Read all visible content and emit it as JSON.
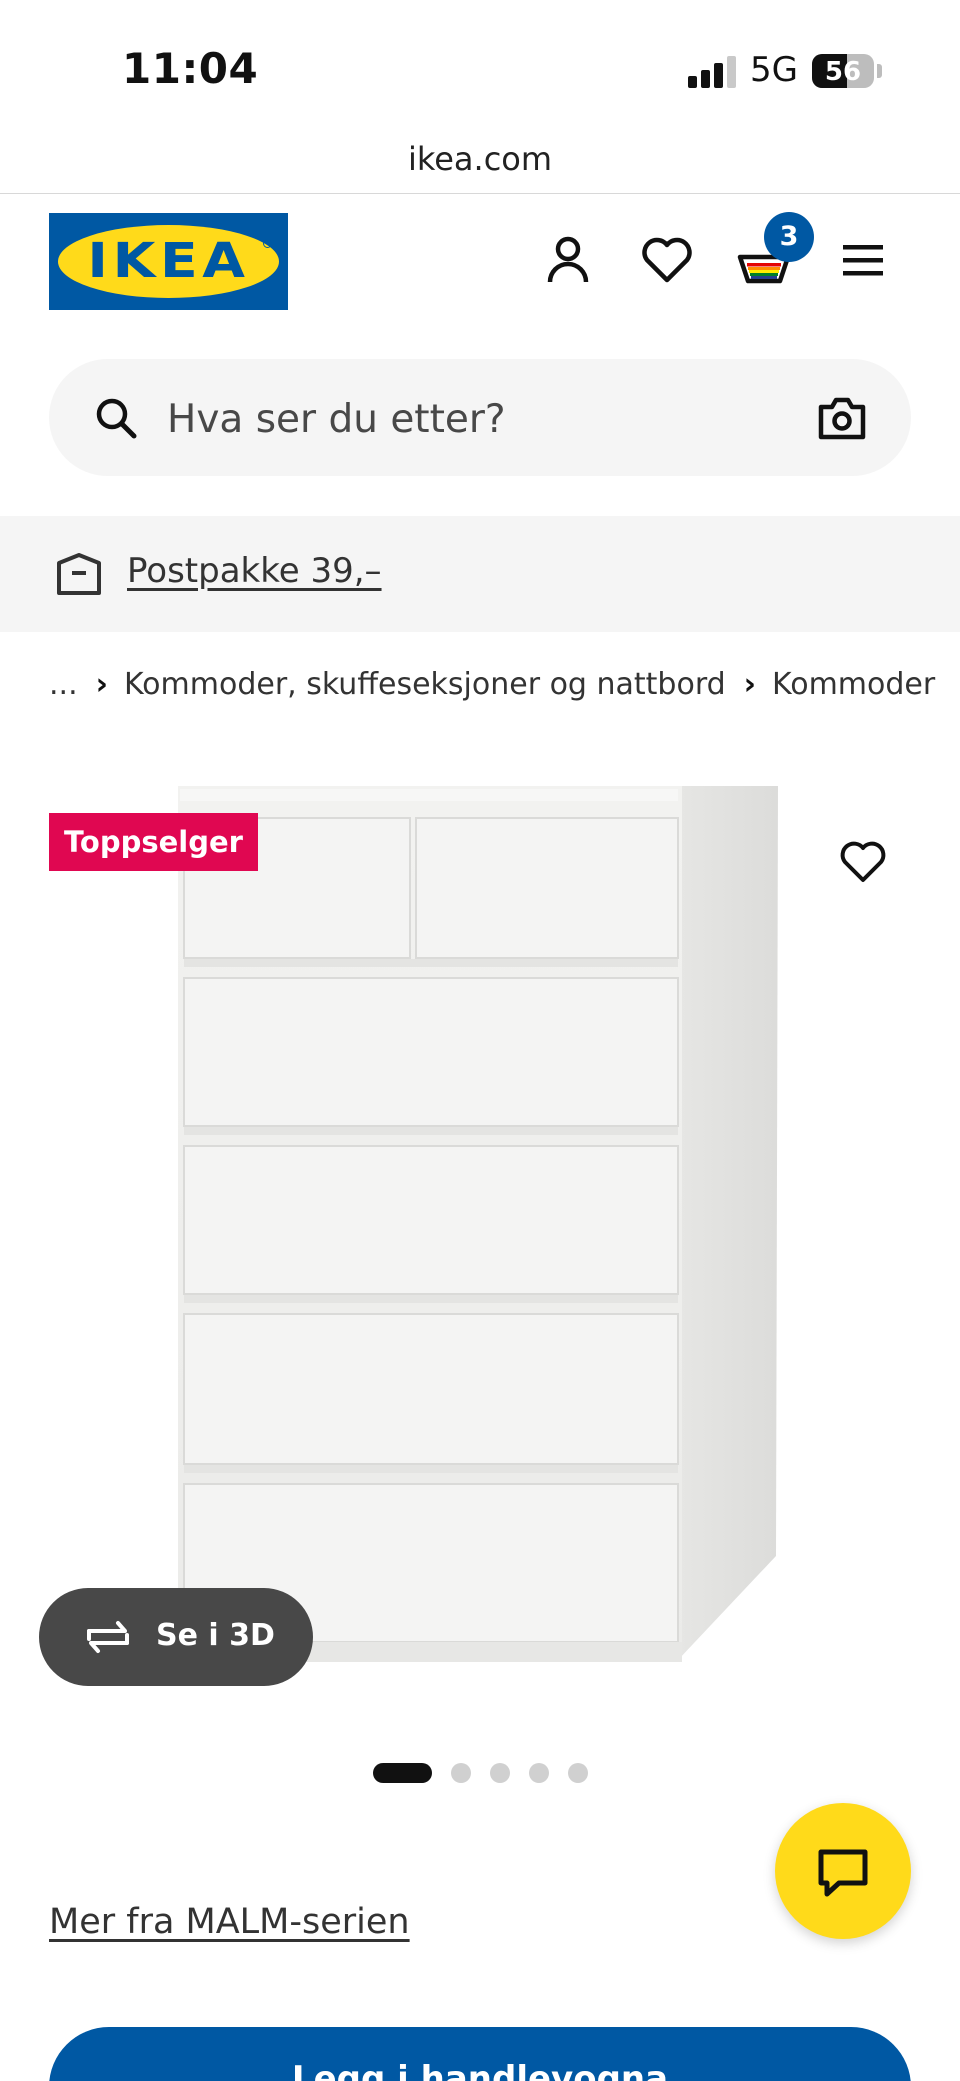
{
  "status_bar": {
    "time": "11:04",
    "network": "5G",
    "battery": "56",
    "battery_level": 0.56
  },
  "browser": {
    "url": "ikea.com"
  },
  "header": {
    "logo_text": "IKEA",
    "cart_count": "3",
    "icons": [
      "account-icon",
      "favourites-icon",
      "cart-icon",
      "menu-icon"
    ]
  },
  "search": {
    "placeholder": "Hva ser du etter?"
  },
  "promo": {
    "text": "Postpakke 39,–"
  },
  "breadcrumb": [
    "...",
    "Kommoder, skuffeseksjoner og nattbord",
    "Kommoder"
  ],
  "product": {
    "badge": "Toppselger",
    "view_3d_label": "Se i 3D",
    "image_count": 5,
    "active_image": 1,
    "series_link": "Mer fra MALM-serien",
    "add_to_cart": "Legg i handlevogna"
  },
  "colors": {
    "ikea_blue": "#0058a3",
    "ikea_yellow": "#ffda1a",
    "badge_red": "#e00751",
    "button_dark": "#484848"
  }
}
